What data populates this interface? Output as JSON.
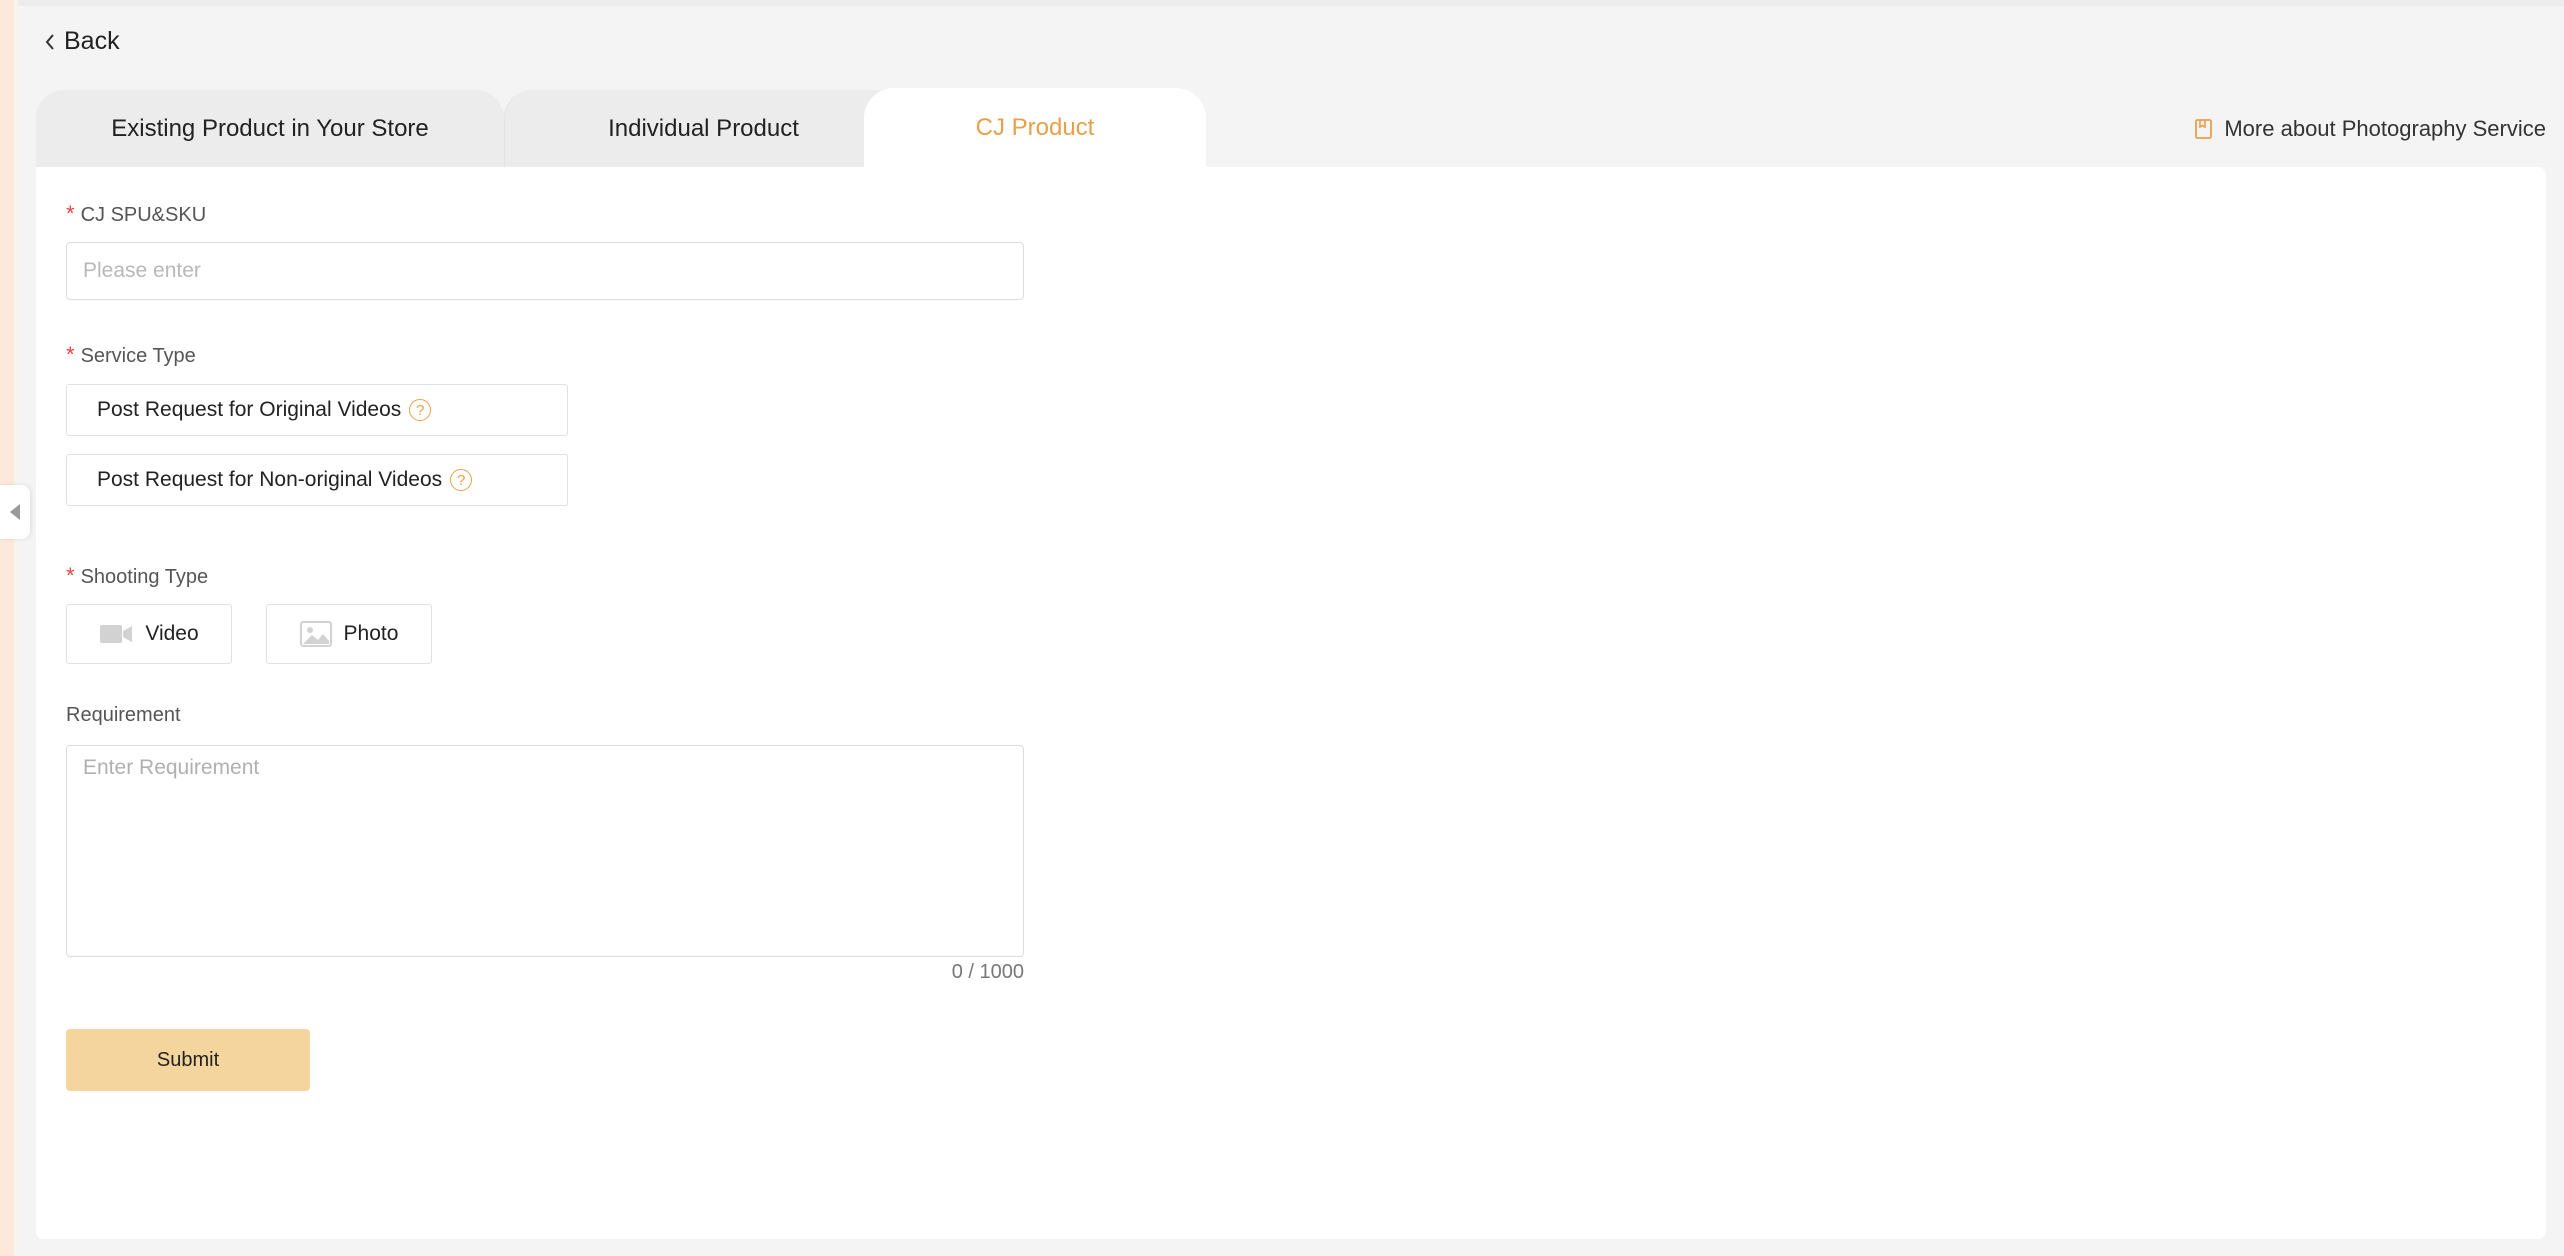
{
  "nav": {
    "back_label": "Back"
  },
  "tabs": [
    {
      "label": "Existing Product in Your Store",
      "active": false
    },
    {
      "label": "Individual Product",
      "active": false
    },
    {
      "label": "CJ Product",
      "active": true
    }
  ],
  "more_link": {
    "label": "More about Photography Service",
    "icon": "book-icon"
  },
  "form": {
    "spu": {
      "label": "CJ SPU&SKU",
      "required_mark": "*",
      "placeholder": "Please enter",
      "value": ""
    },
    "service_type": {
      "label": "Service Type",
      "required_mark": "*",
      "options": [
        {
          "label": "Post Request for Original Videos",
          "help": "?"
        },
        {
          "label": "Post Request for Non-original Videos",
          "help": "?"
        }
      ]
    },
    "shooting_type": {
      "label": "Shooting Type",
      "required_mark": "*",
      "options": [
        {
          "label": "Video",
          "icon": "video-camera-icon"
        },
        {
          "label": "Photo",
          "icon": "image-icon"
        }
      ]
    },
    "requirement": {
      "label": "Requirement",
      "placeholder": "Enter Requirement",
      "value": "",
      "counter": "0 / 1000"
    },
    "submit_label": "Submit"
  },
  "colors": {
    "accent": "#e8a04a",
    "submit_bg": "#f5d59e",
    "required": "#f04040"
  }
}
